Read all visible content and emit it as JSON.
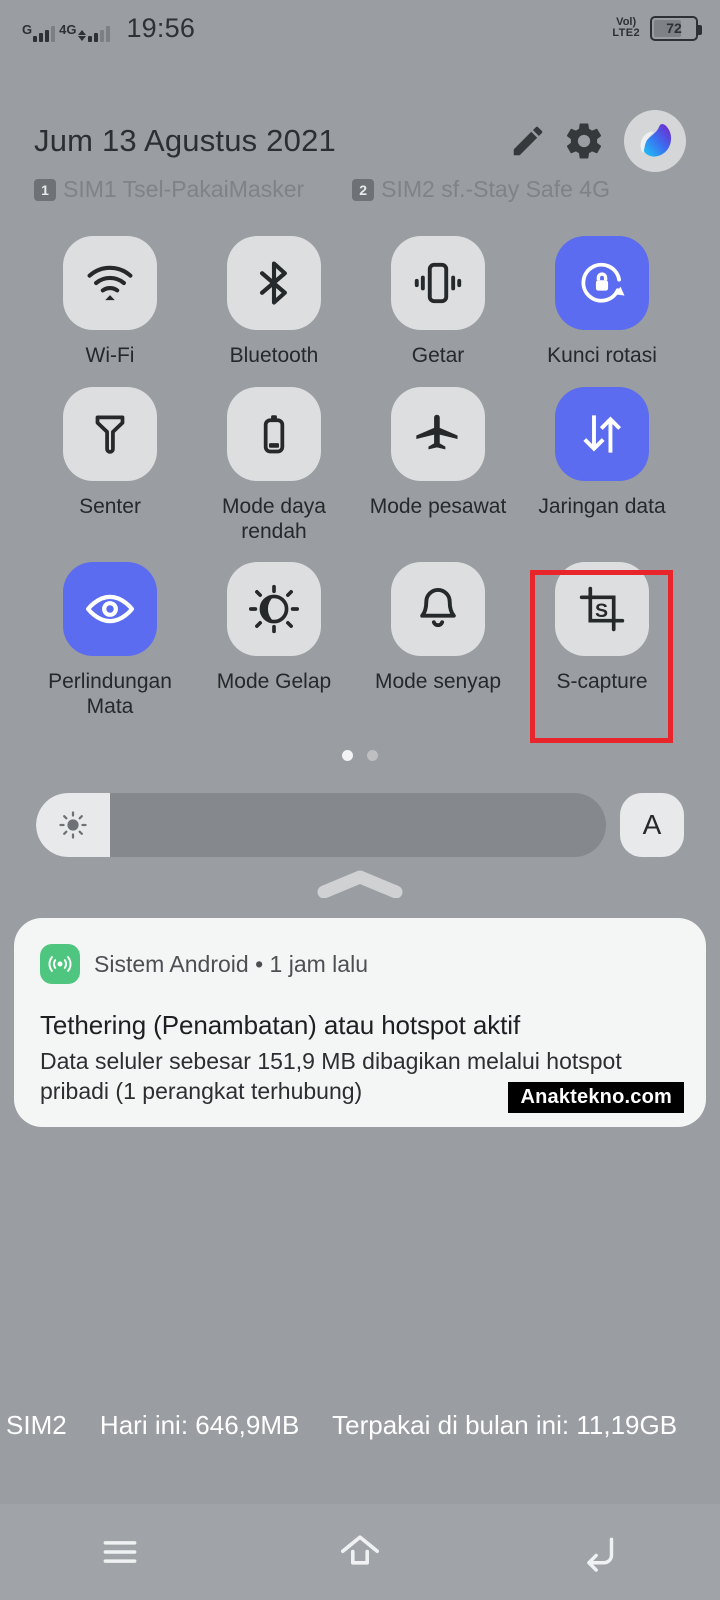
{
  "statusbar": {
    "signal1_label": "G",
    "signal2_label": "4G",
    "time": "19:56",
    "volte_line1": "VoLTE",
    "volte_line2": "LTE2",
    "volte_top": "Vol)",
    "battery_level": "72"
  },
  "header": {
    "date": "Jum 13 Agustus 2021",
    "edit_icon": "pencil-icon",
    "settings_icon": "gear-icon",
    "avatar_icon": "profile-avatar"
  },
  "sims": [
    {
      "badge": "1",
      "name": "SIM1 Tsel-PakaiMasker"
    },
    {
      "badge": "2",
      "name": "SIM2 sf.-Stay Safe 4G"
    }
  ],
  "tiles": [
    [
      {
        "label": "Wi-Fi",
        "icon": "wifi-icon",
        "active": false
      },
      {
        "label": "Bluetooth",
        "icon": "bluetooth-icon",
        "active": false
      },
      {
        "label": "Getar",
        "icon": "vibrate-icon",
        "active": false
      },
      {
        "label": "Kunci rotasi",
        "icon": "rotation-lock-icon",
        "active": true
      }
    ],
    [
      {
        "label": "Senter",
        "icon": "flashlight-icon",
        "active": false
      },
      {
        "label": "Mode daya rendah",
        "icon": "battery-saver-icon",
        "active": false
      },
      {
        "label": "Mode pesawat",
        "icon": "airplane-icon",
        "active": false
      },
      {
        "label": "Jaringan data",
        "icon": "data-network-icon",
        "active": true
      }
    ],
    [
      {
        "label": "Perlindungan Mata",
        "icon": "eye-protection-icon",
        "active": true
      },
      {
        "label": "Mode Gelap",
        "icon": "dark-mode-icon",
        "active": false
      },
      {
        "label": "Mode senyap",
        "icon": "bell-mute-icon",
        "active": false
      },
      {
        "label": "S-capture",
        "icon": "s-capture-icon",
        "active": false
      }
    ]
  ],
  "highlight": {
    "target": "S-capture",
    "color": "#e8252a"
  },
  "pager": {
    "total": 2,
    "current": 1
  },
  "brightness": {
    "icon": "brightness-sun-icon",
    "value_percent": 13,
    "auto_label": "A"
  },
  "handle_icon": "chevron-up-handle",
  "notification": {
    "app_icon": "hotspot-icon",
    "app_name": "Sistem Android",
    "separator": "•",
    "time": "1 jam lalu",
    "title": "Tethering (Penambatan) atau hotspot aktif",
    "body": "Data seluler sebesar 151,9 MB dibagikan melalui hotspot pribadi (1 perangkat terhubung)",
    "watermark": "Anaktekno.com"
  },
  "usage": {
    "sim": "SIM2",
    "today": "Hari ini: 646,9MB",
    "month": "Terpakai di bulan ini: 11,19GB"
  },
  "navbar": {
    "recents_icon": "menu-recents-icon",
    "home_icon": "home-icon",
    "back_icon": "back-icon"
  },
  "colors": {
    "accent": "#5b6cf0",
    "background": "#9a9da1",
    "tile_off": "#dcdedf",
    "highlight": "#e8252a",
    "notif_bg": "#f4f5f5"
  }
}
